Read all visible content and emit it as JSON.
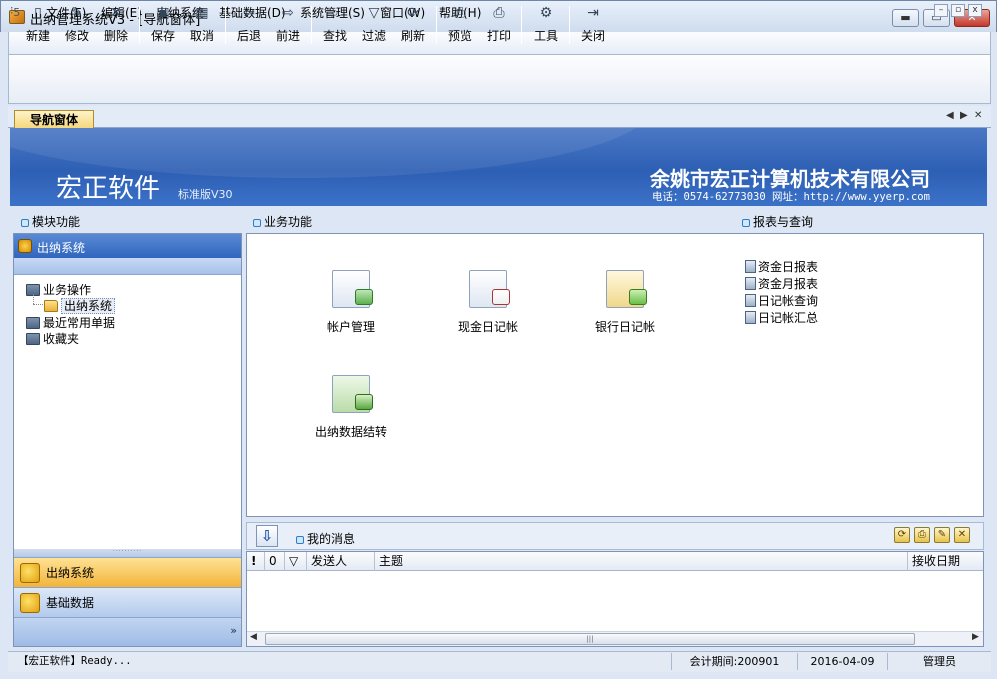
{
  "window": {
    "title": "出纳管理系统V3 - [导航窗体]",
    "min_symbol": "▬",
    "max_symbol": "▭",
    "close_symbol": "✕"
  },
  "menu": {
    "items": [
      "文件(F)",
      "编辑(E)",
      "出纳系统",
      "基础数据(D)",
      "系统管理(S)",
      "窗口(W)",
      "帮助(H)"
    ],
    "mdi": {
      "min": "–",
      "restore": "▫",
      "close": "x"
    }
  },
  "toolbar": {
    "buttons": [
      {
        "label": "新建",
        "icon": "new-doc-icon",
        "glyph": "▯"
      },
      {
        "label": "修改",
        "icon": "edit-icon",
        "glyph": "✎"
      },
      {
        "label": "删除",
        "icon": "delete-icon",
        "glyph": "✕"
      },
      {
        "label": "保存",
        "icon": "save-icon",
        "glyph": "▣"
      },
      {
        "label": "取消",
        "icon": "cancel-icon",
        "glyph": "▦"
      },
      {
        "label": "后退",
        "icon": "back-arrow-icon",
        "glyph": "⇦"
      },
      {
        "label": "前进",
        "icon": "forward-arrow-icon",
        "glyph": "⇨"
      },
      {
        "label": "查找",
        "icon": "binoculars-icon",
        "glyph": "⌕"
      },
      {
        "label": "过滤",
        "icon": "filter-icon",
        "glyph": "▽"
      },
      {
        "label": "刷新",
        "icon": "refresh-icon",
        "glyph": "⟳"
      },
      {
        "label": "预览",
        "icon": "preview-icon",
        "glyph": "⎙"
      },
      {
        "label": "打印",
        "icon": "printer-icon",
        "glyph": "⎙"
      },
      {
        "label": "工具",
        "icon": "tools-icon",
        "glyph": "⚙"
      },
      {
        "label": "关闭",
        "icon": "exit-door-icon",
        "glyph": "⇥"
      }
    ]
  },
  "tabs": {
    "active": "导航窗体",
    "prev": "◀",
    "next": "▶",
    "close": "✕"
  },
  "banner": {
    "brand": "宏正软件",
    "edition": "标准版V30",
    "company": "余姚市宏正计算机技术有限公司",
    "contact": "电话：0574-62773030   网址：http://www.yyerp.com"
  },
  "sections": {
    "modules": "模块功能",
    "business": "业务功能",
    "reports": "报表与查询"
  },
  "left_panel": {
    "header": "出纳系统",
    "tree": [
      {
        "label": "业务操作"
      },
      {
        "label": "出纳系统"
      },
      {
        "label": "最近常用单据"
      },
      {
        "label": "收藏夹"
      }
    ],
    "splitter": "··········",
    "nav_buttons": [
      "出纳系统",
      "基础数据"
    ],
    "more": "»"
  },
  "business_functions": [
    {
      "label": "帐户管理",
      "icon": "account-management-icon"
    },
    {
      "label": "现金日记帐",
      "icon": "cash-journal-icon"
    },
    {
      "label": "银行日记帐",
      "icon": "bank-journal-icon"
    },
    {
      "label": "出纳数据结转",
      "icon": "data-carryover-icon"
    }
  ],
  "reports": [
    "资金日报表",
    "资金月报表",
    "日记帐查询",
    "日记帐汇总"
  ],
  "messages": {
    "title": "我的消息",
    "down": "⇩",
    "tools": [
      "⟳",
      "⎙",
      "✎",
      "✕"
    ],
    "columns": [
      "!",
      "0",
      "▽",
      "发送人",
      "主题",
      "接收日期"
    ],
    "scroll_thumb": "|||",
    "scroll_left": "◀",
    "scroll_right": "▶"
  },
  "status": {
    "ready": "【宏正软件】Ready...",
    "period": "会计期间:200901",
    "date": "2016-04-09",
    "user": "管理员"
  },
  "colors": {
    "banner": "#2d5fb4",
    "nav_active": "#f2b43a",
    "nav_inactive": "#b3caec"
  }
}
